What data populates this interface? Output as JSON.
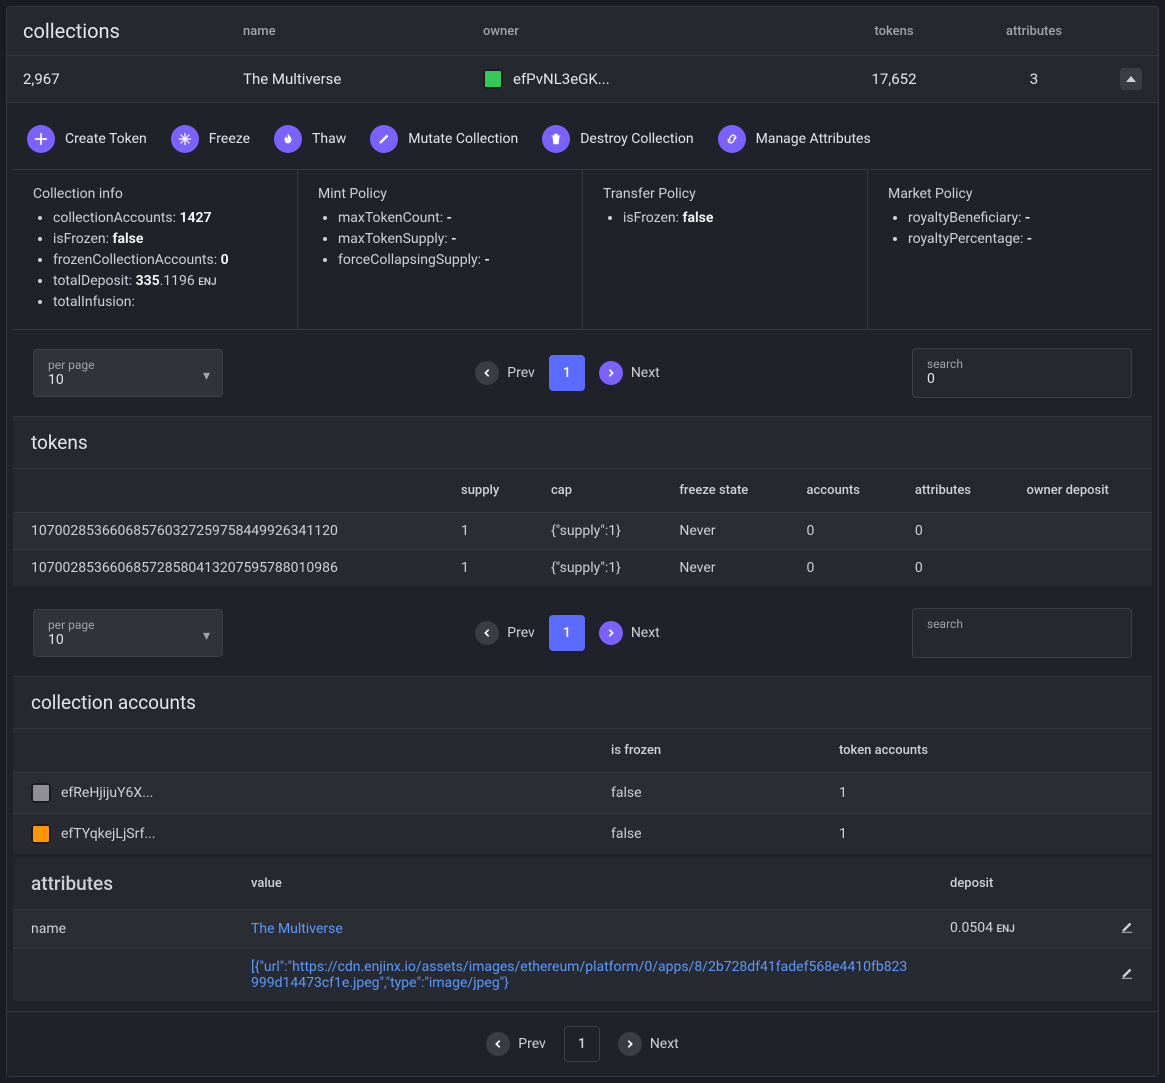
{
  "header": {
    "title": "collections",
    "columns": {
      "name": "name",
      "owner": "owner",
      "tokens": "tokens",
      "attributes": "attributes"
    },
    "row": {
      "id": "2,967",
      "name": "The Multiverse",
      "owner": "efPvNL3eGK...",
      "tokens": "17,652",
      "attributes": "3"
    }
  },
  "actions": {
    "create": "Create Token",
    "freeze": "Freeze",
    "thaw": "Thaw",
    "mutate": "Mutate Collection",
    "destroy": "Destroy Collection",
    "manage": "Manage Attributes"
  },
  "policies": {
    "info": {
      "title": "Collection info",
      "collectionAccounts_label": "collectionAccounts:",
      "collectionAccounts": "1427",
      "isFrozen_label": "isFrozen:",
      "isFrozen": "false",
      "frozenAccounts_label": "frozenCollectionAccounts:",
      "frozenAccounts": "0",
      "totalDeposit_label": "totalDeposit:",
      "totalDeposit_int": "335",
      "totalDeposit_dec": ".1196",
      "totalDeposit_unit": "ENJ",
      "totalInfusion_label": "totalInfusion:"
    },
    "mint": {
      "title": "Mint Policy",
      "maxTokenCount_label": "maxTokenCount:",
      "maxTokenCount": "-",
      "maxTokenSupply_label": "maxTokenSupply:",
      "maxTokenSupply": "-",
      "forceCollapsing_label": "forceCollapsingSupply:",
      "forceCollapsing": "-"
    },
    "transfer": {
      "title": "Transfer Policy",
      "isFrozen_label": "isFrozen:",
      "isFrozen": "false"
    },
    "market": {
      "title": "Market Policy",
      "royaltyBeneficiary_label": "royaltyBeneficiary:",
      "royaltyBeneficiary": "-",
      "royaltyPercentage_label": "royaltyPercentage:",
      "royaltyPercentage": "-"
    }
  },
  "pager": {
    "per_page_label": "per page",
    "per_page_value": "10",
    "prev": "Prev",
    "next": "Next",
    "page": "1",
    "search_label": "search",
    "search_value": "0"
  },
  "tokens_table": {
    "title": "tokens",
    "cols": {
      "supply": "supply",
      "cap": "cap",
      "freeze": "freeze state",
      "accounts": "accounts",
      "attributes": "attributes",
      "deposit": "owner deposit"
    },
    "rows": [
      {
        "id": "107002853660685760327259758449926341120",
        "supply": "1",
        "cap": "{\"supply\":1}",
        "freeze": "Never",
        "accounts": "0",
        "attributes": "0"
      },
      {
        "id": "107002853660685728580413207595788010986",
        "supply": "1",
        "cap": "{\"supply\":1}",
        "freeze": "Never",
        "accounts": "0",
        "attributes": "0"
      }
    ]
  },
  "pager2": {
    "per_page_label": "per page",
    "per_page_value": "10",
    "prev": "Prev",
    "next": "Next",
    "page": "1",
    "search_label": "search",
    "search_value": ""
  },
  "accounts_table": {
    "title": "collection accounts",
    "cols": {
      "frozen": "is frozen",
      "token_accounts": "token accounts"
    },
    "rows": [
      {
        "addr": "efReHjijuY6X...",
        "frozen": "false",
        "ta": "1",
        "iconClass": "gray"
      },
      {
        "addr": "efTYqkejLjSrf...",
        "frozen": "false",
        "ta": "1",
        "iconClass": "orange"
      }
    ]
  },
  "attributes_table": {
    "title": "attributes",
    "cols": {
      "value": "value",
      "deposit": "deposit"
    },
    "rows": [
      {
        "key": "name",
        "value": "The Multiverse",
        "deposit": "0.0504",
        "deposit_unit": "ENJ"
      },
      {
        "key": "",
        "value": "[{\"url\":\"https://cdn.enjinx.io/assets/images/ethereum/platform/0/apps/8/2b728df41fadef568e4410fb823999d14473cf1e.jpeg\",\"type\":\"image/jpeg\"}",
        "deposit": ""
      }
    ]
  },
  "bottom_pager": {
    "prev": "Prev",
    "page": "1",
    "next": "Next"
  }
}
